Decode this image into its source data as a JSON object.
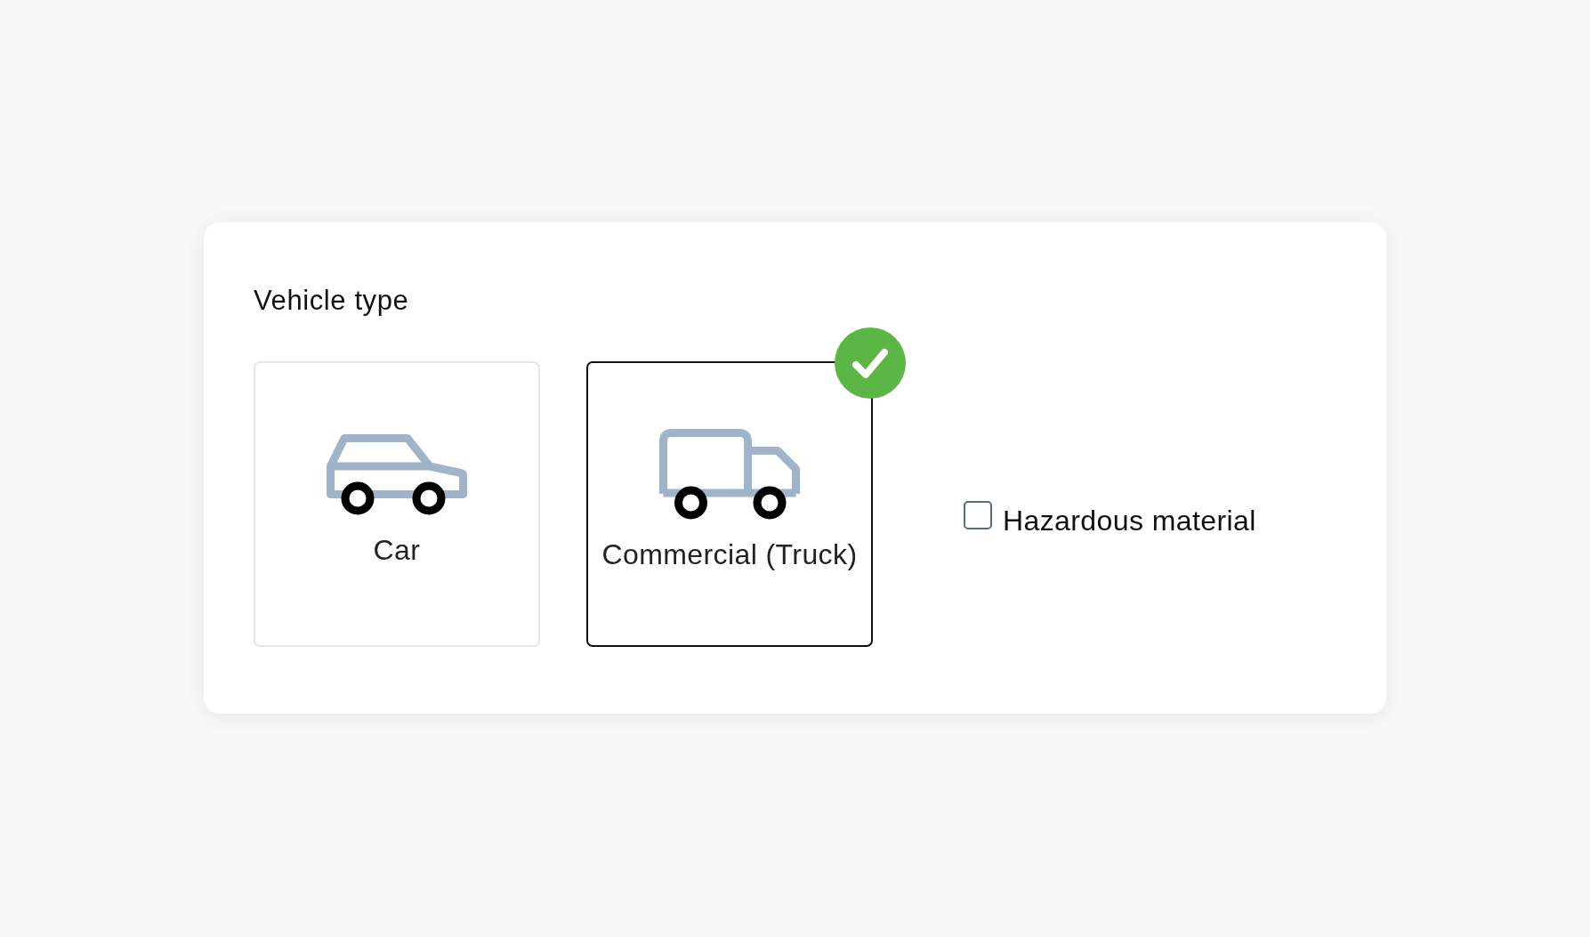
{
  "title": "Vehicle type",
  "vehicle_types": [
    {
      "kind": "car",
      "label": "Car",
      "selected": false
    },
    {
      "kind": "truck",
      "label": "Commercial (Truck)",
      "selected": true
    }
  ],
  "hazardous_material": {
    "label": "Hazardous material",
    "checked": false
  }
}
